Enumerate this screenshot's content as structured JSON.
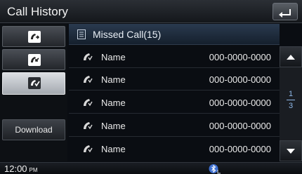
{
  "header": {
    "title": "Call History"
  },
  "category": {
    "label": "Missed Call(15)"
  },
  "left_menu": {
    "download_label": "Download"
  },
  "calls": [
    {
      "name": "Name",
      "number": "000-0000-0000"
    },
    {
      "name": "Name",
      "number": "000-0000-0000"
    },
    {
      "name": "Name",
      "number": "000-0000-0000"
    },
    {
      "name": "Name",
      "number": "000-0000-0000"
    },
    {
      "name": "Name",
      "number": "000-0000-0000"
    }
  ],
  "pager": {
    "current": "1",
    "total": "3"
  },
  "status": {
    "time": "12:00",
    "ampm": "PM"
  },
  "colors": {
    "accent": "#8fb8e8",
    "selected_button": "#c8ccd1"
  },
  "icons": [
    "back-icon",
    "outgoing-call-icon",
    "received-call-icon",
    "missed-call-icon",
    "document-icon",
    "phone-icon",
    "scroll-up-icon",
    "scroll-down-icon",
    "bluetooth-icon"
  ]
}
